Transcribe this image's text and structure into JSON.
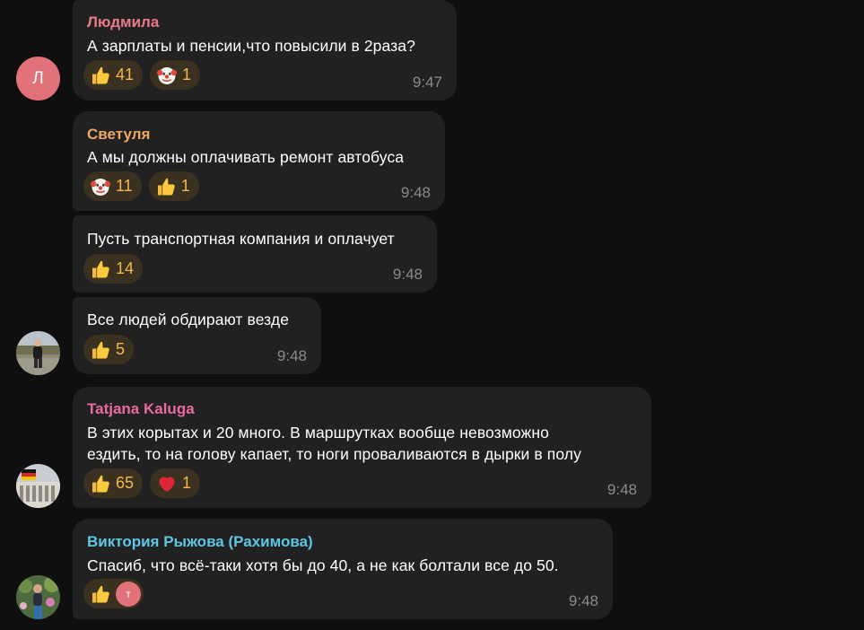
{
  "colors": {
    "background": "#0f0f0f",
    "bubble": "#212121",
    "reaction_chip": "#3a3121",
    "reaction_count": "#f2b84b",
    "timestamp": "#8a8a8a"
  },
  "messages": [
    {
      "sender": "Людмила",
      "sender_color": "#e97a87",
      "avatar_letter": "Л",
      "text": "А зарплаты и пенсии,что повысили в 2раза?",
      "reactions": [
        {
          "emoji": "thumbs-up-icon",
          "count": "41"
        },
        {
          "emoji": "clown-face-icon",
          "count": "1"
        }
      ],
      "time": "9:47"
    },
    {
      "sender": "Светуля",
      "sender_color": "#f0a763",
      "text": "А мы должны оплачивать ремонт автобуса",
      "reactions": [
        {
          "emoji": "clown-face-icon",
          "count": "11"
        },
        {
          "emoji": "thumbs-up-icon",
          "count": "1"
        }
      ],
      "time": "9:48"
    },
    {
      "text": "Пусть транспортная компания и оплачует",
      "reactions": [
        {
          "emoji": "thumbs-up-icon",
          "count": "14"
        }
      ],
      "time": "9:48"
    },
    {
      "text": "Все людей обдирают везде",
      "reactions": [
        {
          "emoji": "thumbs-up-icon",
          "count": "5"
        }
      ],
      "time": "9:48"
    },
    {
      "sender": "Tatjana Kaluga",
      "sender_color": "#ea6aa0",
      "text_lines": [
        "В этих корытах и 20 много. В маршрутках вообще невозможно",
        "ездить, то на голову капает, то ноги проваливаются в дырки в полу"
      ],
      "reactions": [
        {
          "emoji": "thumbs-up-icon",
          "count": "65"
        },
        {
          "emoji": "red-heart-icon",
          "count": "1"
        }
      ],
      "time": "9:48"
    },
    {
      "sender": "Виктория Рыжова (Рахимова)",
      "sender_color": "#5ec6e0",
      "text": "Спасиб, что всё-таки хотя бы до 40, а не как болтали все до 50.",
      "reactions": [
        {
          "emoji": "thumbs-up-icon",
          "reactor_letter": "т"
        }
      ],
      "time": "9:48"
    }
  ]
}
